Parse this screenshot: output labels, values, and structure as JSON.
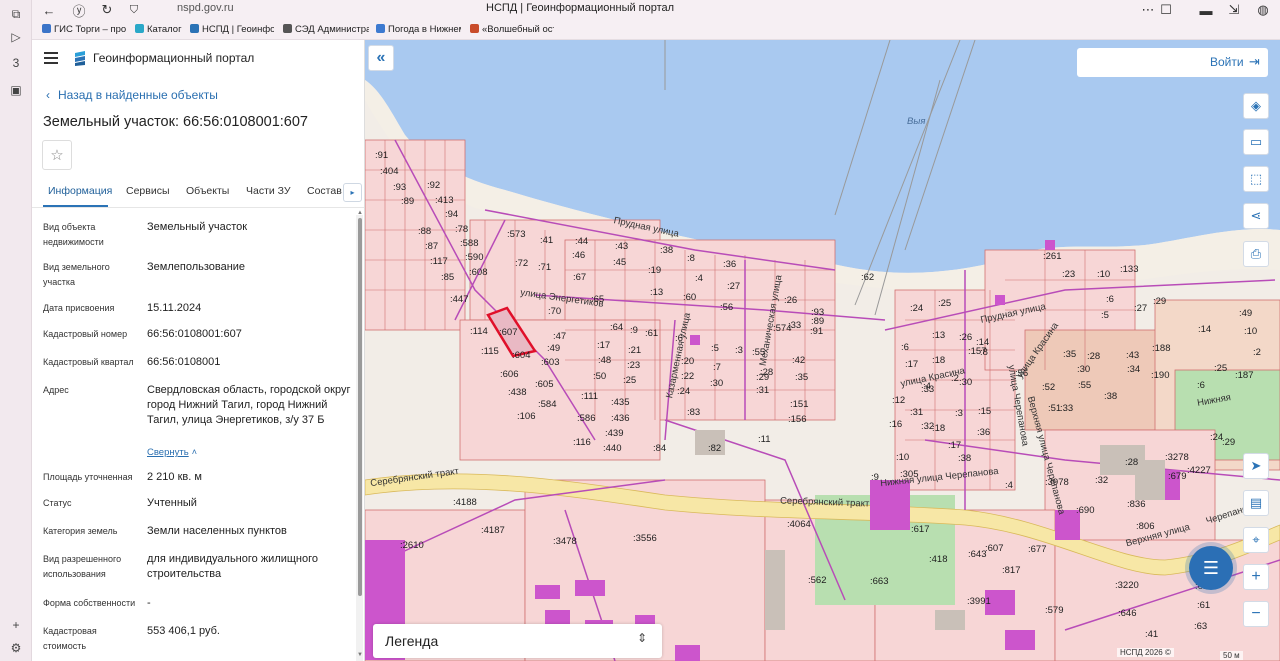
{
  "browser": {
    "url": "nspd.gov.ru",
    "tab_title": "НСПД | Геоинформационный портал",
    "bookmarks": [
      {
        "label": "ГИС Торги – про",
        "color": "#3b74c8"
      },
      {
        "label": "Каталог",
        "color": "#2aa8c8"
      },
      {
        "label": "НСПД | Геоинфор",
        "color": "#2b73b6"
      },
      {
        "label": "СЭД Администра",
        "color": "#555555"
      },
      {
        "label": "Погода в Нижнем",
        "color": "#3d7ad0"
      },
      {
        "label": "«Волшебный ост",
        "color": "#c94c2a"
      }
    ]
  },
  "header": {
    "portal_name": "Геоинформационный портал"
  },
  "panel": {
    "back_label": "Назад в найденные объекты",
    "title": "Земельный участок: 66:56:0108001:607",
    "tabs": [
      "Информация",
      "Сервисы",
      "Объекты",
      "Части ЗУ",
      "Состав"
    ],
    "properties": [
      {
        "key": "Вид объекта недвижимости",
        "value": "Земельный участок"
      },
      {
        "key": "Вид земельного участка",
        "value": "Землепользование"
      },
      {
        "key": "Дата присвоения",
        "value": "15.11.2024"
      },
      {
        "key": "Кадастровый номер",
        "value": "66:56:0108001:607"
      },
      {
        "key": "Кадастровый квартал",
        "value": "66:56:0108001"
      },
      {
        "key": "Адрес",
        "value": "Свердловская область, городской округ город Нижний Тагил, город Нижний Тагил, улица Энергетиков, з/у 37 Б"
      },
      {
        "key": "Площадь уточненная",
        "value": "2 210 кв. м"
      },
      {
        "key": "Статус",
        "value": "Учтенный"
      },
      {
        "key": "Категория земель",
        "value": "Земли населенных пунктов"
      },
      {
        "key": "Вид разрешенного использования",
        "value": "для индивидуального жилищного строительства"
      },
      {
        "key": "Форма собственности",
        "value": "-"
      },
      {
        "key": "Кадастровая стоимость",
        "value": "553 406,1 руб."
      }
    ],
    "collapse_label": "Свернуть"
  },
  "map": {
    "login_label": "Войти",
    "legend_label": "Легенда",
    "copyright": "НСПД 2026 ©",
    "scale": "50 м",
    "water_label": "Выя",
    "streets": [
      "Прудная улица",
      "улица Энергетиков",
      "Механическая улица",
      "Казарменная улица",
      "Серебрянский тракт",
      "Серебрянский тракт",
      "Прудная улица",
      "улица Красина",
      "улица Красина",
      "улица Черепанова",
      "Нижняя улица Черепанова",
      "Верхняя улица Черепанова",
      "Нижняя",
      "Верхняя улица",
      "Черепанова"
    ],
    "parcel_labels": [
      ":91",
      ":404",
      ":93",
      ":89",
      ":92",
      ":413",
      ":94",
      ":88",
      ":87",
      ":117",
      ":85",
      ":78",
      ":588",
      ":590",
      ":608",
      ":447",
      ":573",
      ":41",
      ":44",
      ":72",
      ":71",
      ":46",
      ":43",
      ":45",
      ":38",
      ":19",
      ":67",
      ":13",
      ":65",
      ":8",
      ":36",
      ":4",
      ":27",
      ":60",
      ":56",
      ":70",
      ":47",
      ":49",
      ":114",
      ":607",
      ":115",
      ":604",
      ":603",
      ":606",
      ":605",
      ":438",
      ":584",
      ":106",
      ":64",
      ":9",
      ":61",
      ":6",
      ":5",
      ":3",
      ":17",
      ":21",
      ":48",
      ":23",
      ":50",
      ":25",
      ":111",
      ":435",
      ":586",
      ":436",
      ":439",
      ":116",
      ":440",
      ":20",
      ":22",
      ":7",
      ":30",
      ":24",
      ":29",
      ":31",
      ":83",
      ":55",
      ":28",
      ":35",
      ":151",
      ":156",
      ":42",
      ":33",
      ":89",
      ":26",
      ":93",
      ":574",
      ":91",
      ":62",
      ":84",
      ":82",
      ":11",
      ":24",
      ":25",
      ":6",
      ":13",
      ":26",
      ":14",
      ":17",
      ":18",
      ":157",
      ":8",
      ":2",
      ":4",
      ":12",
      ":33",
      ":30",
      ":31",
      ":3",
      ":16",
      ":32",
      ":15",
      ":18",
      ":36",
      ":17",
      ":305",
      ":10",
      ":38",
      ":9",
      ":4",
      ":261",
      ":23",
      ":10",
      ":133",
      ":6",
      ":5",
      ":29",
      ":27",
      ":28",
      ":35",
      ":43",
      ":30",
      ":34",
      ":56",
      ":52",
      ":55",
      ":33",
      ":51",
      ":38",
      ":49",
      ":14",
      ":10",
      ":188",
      ":2",
      ":190",
      ":25",
      ":6",
      ":187",
      ":24",
      ":29",
      ":28",
      ":3278",
      ":32",
      ":3978",
      ":4227",
      ":679",
      ":690",
      ":836",
      ":806",
      ":4188",
      ":4187",
      ":2610",
      ":3478",
      ":3556",
      ":4064",
      ":562",
      ":663",
      ":617",
      ":418",
      ":643",
      ":607",
      ":817",
      ":3991",
      ":677",
      ":3220",
      ":2735",
      ":612",
      ":61",
      ":579",
      ":646",
      ":41",
      ":63"
    ]
  }
}
